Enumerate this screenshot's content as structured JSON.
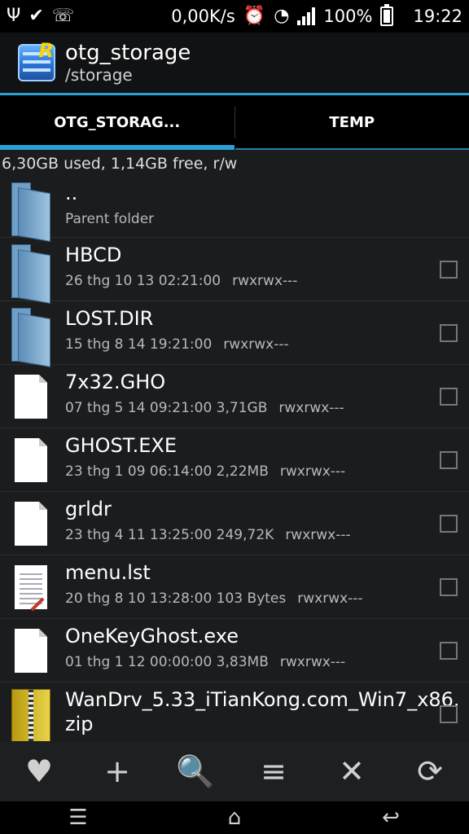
{
  "status_bar": {
    "speed": "0,00K/s",
    "battery": "100%",
    "time": "19:22"
  },
  "app_bar": {
    "title": "otg_storage",
    "subtitle": "/storage"
  },
  "tabs": [
    {
      "label": "OTG_STORAG..."
    },
    {
      "label": "TEMP"
    }
  ],
  "storage_info": "6,30GB used, 1,14GB free, r/w",
  "files": [
    {
      "name": "..",
      "meta": "Parent folder",
      "perm": "",
      "icon": "folder-icon"
    },
    {
      "name": "HBCD",
      "meta": "26 thg 10 13 02:21:00",
      "perm": "rwxrwx---",
      "icon": "folder-icon"
    },
    {
      "name": "LOST.DIR",
      "meta": "15 thg 8 14 19:21:00",
      "perm": "rwxrwx---",
      "icon": "folder-icon"
    },
    {
      "name": "7x32.GHO",
      "meta": "07 thg 5 14 09:21:00  3,71GB",
      "perm": "rwxrwx---",
      "icon": "file-icon"
    },
    {
      "name": "GHOST.EXE",
      "meta": "23 thg 1 09 06:14:00  2,22MB",
      "perm": "rwxrwx---",
      "icon": "file-icon"
    },
    {
      "name": "grldr",
      "meta": "23 thg 4 11 13:25:00  249,72K",
      "perm": "rwxrwx---",
      "icon": "file-icon"
    },
    {
      "name": "menu.lst",
      "meta": "20 thg 8 10 13:28:00  103 Bytes",
      "perm": "rwxrwx---",
      "icon": "text-file-icon"
    },
    {
      "name": "OneKeyGhost.exe",
      "meta": "01 thg 1 12 00:00:00  3,83MB",
      "perm": "rwxrwx---",
      "icon": "file-icon"
    },
    {
      "name": "WanDrv_5.33_iTianKong.com_Win7_x86.zip",
      "meta": "",
      "perm": "",
      "icon": "zip-icon"
    }
  ],
  "toolbar": {
    "favorite": "♥",
    "add": "+",
    "search": "🔍",
    "sort": "≡",
    "close": "✕",
    "refresh": "⟳"
  },
  "navbar": {
    "menu": "☰",
    "home": "⌂",
    "back": "↩"
  }
}
